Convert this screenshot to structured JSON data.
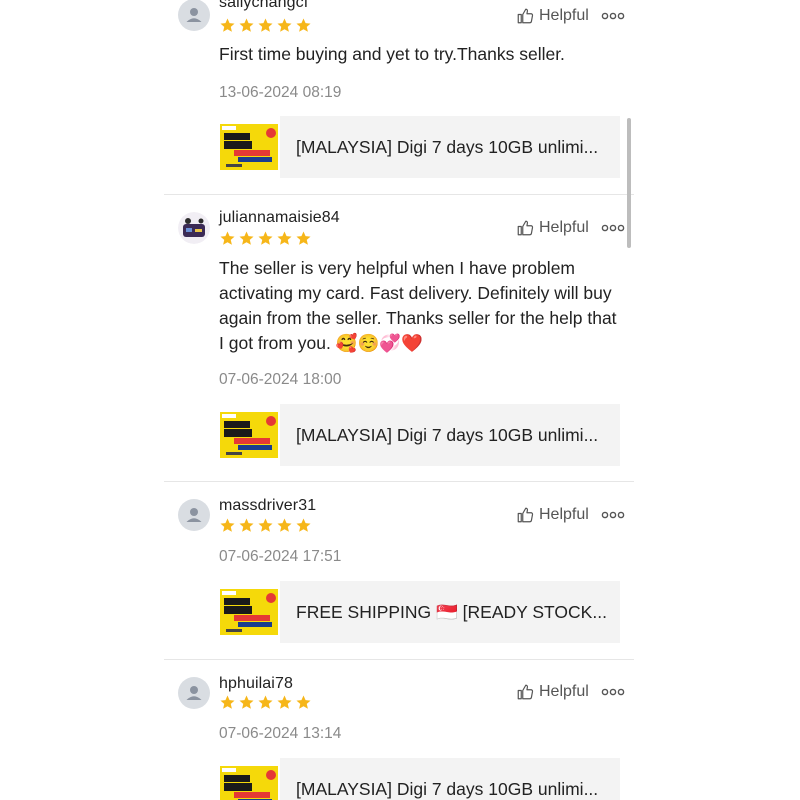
{
  "helpful_label": "Helpful",
  "colors": {
    "star": "#f6b619",
    "accent": "#ee4d2d"
  },
  "reviews": [
    {
      "username": "sallychangcf",
      "rating": 5,
      "text": "First time buying and yet to try.Thanks seller.",
      "date": "13-06-2024 08:19",
      "product_title": "[MALAYSIA] Digi 7 days 10GB unlimi..."
    },
    {
      "username": "juliannamaisie84",
      "rating": 5,
      "text": "The seller is very helpful when I have problem activating my card. Fast delivery. Definitely will buy again from the seller. Thanks seller for the help that I got from you. 🥰☺️💞❤️",
      "date": "07-06-2024 18:00",
      "product_title": "[MALAYSIA] Digi 7 days 10GB unlimi..."
    },
    {
      "username": "massdriver31",
      "rating": 5,
      "text": "",
      "date": "07-06-2024 17:51",
      "product_title": "FREE SHIPPING 🇸🇬 [READY STOCK..."
    },
    {
      "username": "hphuilai78",
      "rating": 5,
      "text": "",
      "date": "07-06-2024 13:14",
      "product_title": "[MALAYSIA] Digi 7 days 10GB unlimi..."
    }
  ]
}
